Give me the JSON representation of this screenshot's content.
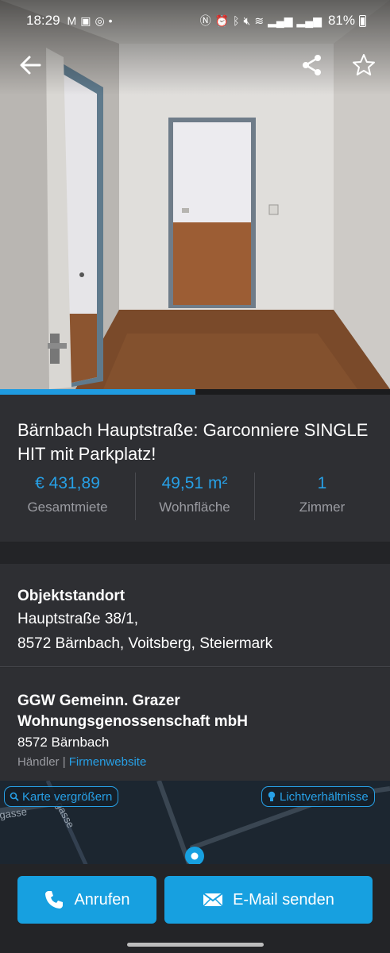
{
  "status_bar": {
    "time": "18:29",
    "battery": "81%",
    "left_icons": [
      "gmail-icon",
      "gallery-icon",
      "whatsapp-icon",
      "dot-icon"
    ],
    "right_icons": [
      "nfc-icon",
      "alarm-icon",
      "bluetooth-icon",
      "mute-icon",
      "wifi-icon",
      "signal-icon",
      "signal2-icon",
      "battery-icon"
    ]
  },
  "gallery": {
    "progress_fraction": 0.5
  },
  "listing": {
    "title": "Bärnbach  Hauptstraße: Garconniere SINGLE HIT mit Parkplatz!",
    "facts": [
      {
        "value": "€ 431,89",
        "label": "Gesamtmiete"
      },
      {
        "value": "49,51 m²",
        "label": "Wohnfläche"
      },
      {
        "value": "1",
        "label": "Zimmer"
      }
    ]
  },
  "location": {
    "heading": "Objektstandort",
    "line1": "Hauptstraße 38/1,",
    "line2": "8572 Bärnbach, Voitsberg, Steiermark"
  },
  "dealer": {
    "name": "GGW Gemeinn. Grazer Wohnungsgenossenschaft mbH",
    "city": "8572 Bärnbach",
    "type": "Händler",
    "separator": " | ",
    "website_link": "Firmenwebsite"
  },
  "map": {
    "zoom_label": "Karte vergrößern",
    "light_label": "Lichtverhältnisse",
    "street_labels": [
      "gasse",
      "gasse"
    ]
  },
  "actions": {
    "call_label": "Anrufen",
    "mail_label": "E-Mail senden"
  },
  "colors": {
    "accent": "#17a0e0",
    "background": "#2e2f33",
    "muted_text": "#9a9ba1"
  }
}
